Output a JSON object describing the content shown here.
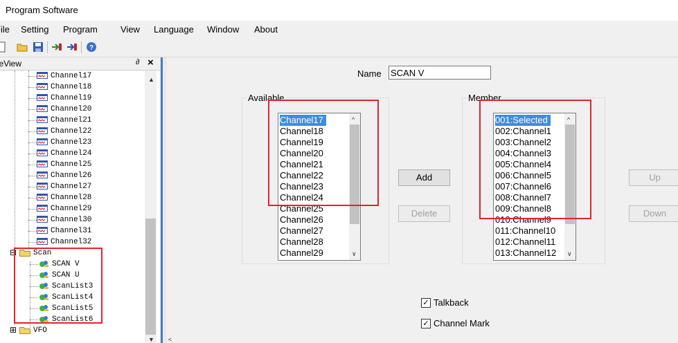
{
  "window": {
    "title": "Program Software"
  },
  "menu": [
    "File",
    "Setting",
    "Program",
    "View",
    "Language",
    "Window",
    "About"
  ],
  "toolbar": {
    "icons": [
      "new-file-icon",
      "open-folder-icon",
      "save-disk-icon",
      "read-from-radio-icon",
      "write-to-radio-icon",
      "help-icon"
    ]
  },
  "tree": {
    "header": "TreeView",
    "pin": "∂",
    "close": "×",
    "channels": [
      "Channel17",
      "Channel18",
      "Channel19",
      "Channel20",
      "Channel21",
      "Channel22",
      "Channel23",
      "Channel24",
      "Channel25",
      "Channel26",
      "Channel27",
      "Channel28",
      "Channel29",
      "Channel30",
      "Channel31",
      "Channel32"
    ],
    "scan_folder": "Scan",
    "scan_items": [
      "SCAN V",
      "SCAN U",
      "ScanList3",
      "ScanList4",
      "ScanList5",
      "ScanList6"
    ],
    "vfo_folder": "VFO",
    "expander_expanded": "⊟",
    "expander_collapsed": "⊞"
  },
  "form": {
    "name_label": "Name",
    "name_value": "SCAN V",
    "available_label": "Available",
    "member_label": "Member",
    "available_items": [
      "Channel17",
      "Channel18",
      "Channel19",
      "Channel20",
      "Channel21",
      "Channel22",
      "Channel23",
      "Channel24",
      "Channel25",
      "Channel26",
      "Channel27",
      "Channel28",
      "Channel29"
    ],
    "member_items": [
      "001:Selected",
      "002:Channel1",
      "003:Channel2",
      "004:Channel3",
      "005:Channel4",
      "006:Channel5",
      "007:Channel6",
      "008:Channel7",
      "009:Channel8",
      "010:Channel9",
      "011:Channel10",
      "012:Channel11",
      "013:Channel12"
    ],
    "add_label": "Add",
    "delete_label": "Delete",
    "up_label": "Up",
    "down_label": "Down",
    "talkback_label": "Talkback",
    "channel_mark_label": "Channel Mark",
    "talkback_checked": true,
    "channel_mark_checked": true,
    "check_glyph": "✓"
  },
  "colors": {
    "selection": "#3c8de0",
    "highlight_box": "#e3222b",
    "splitter": "#4a78c8"
  }
}
